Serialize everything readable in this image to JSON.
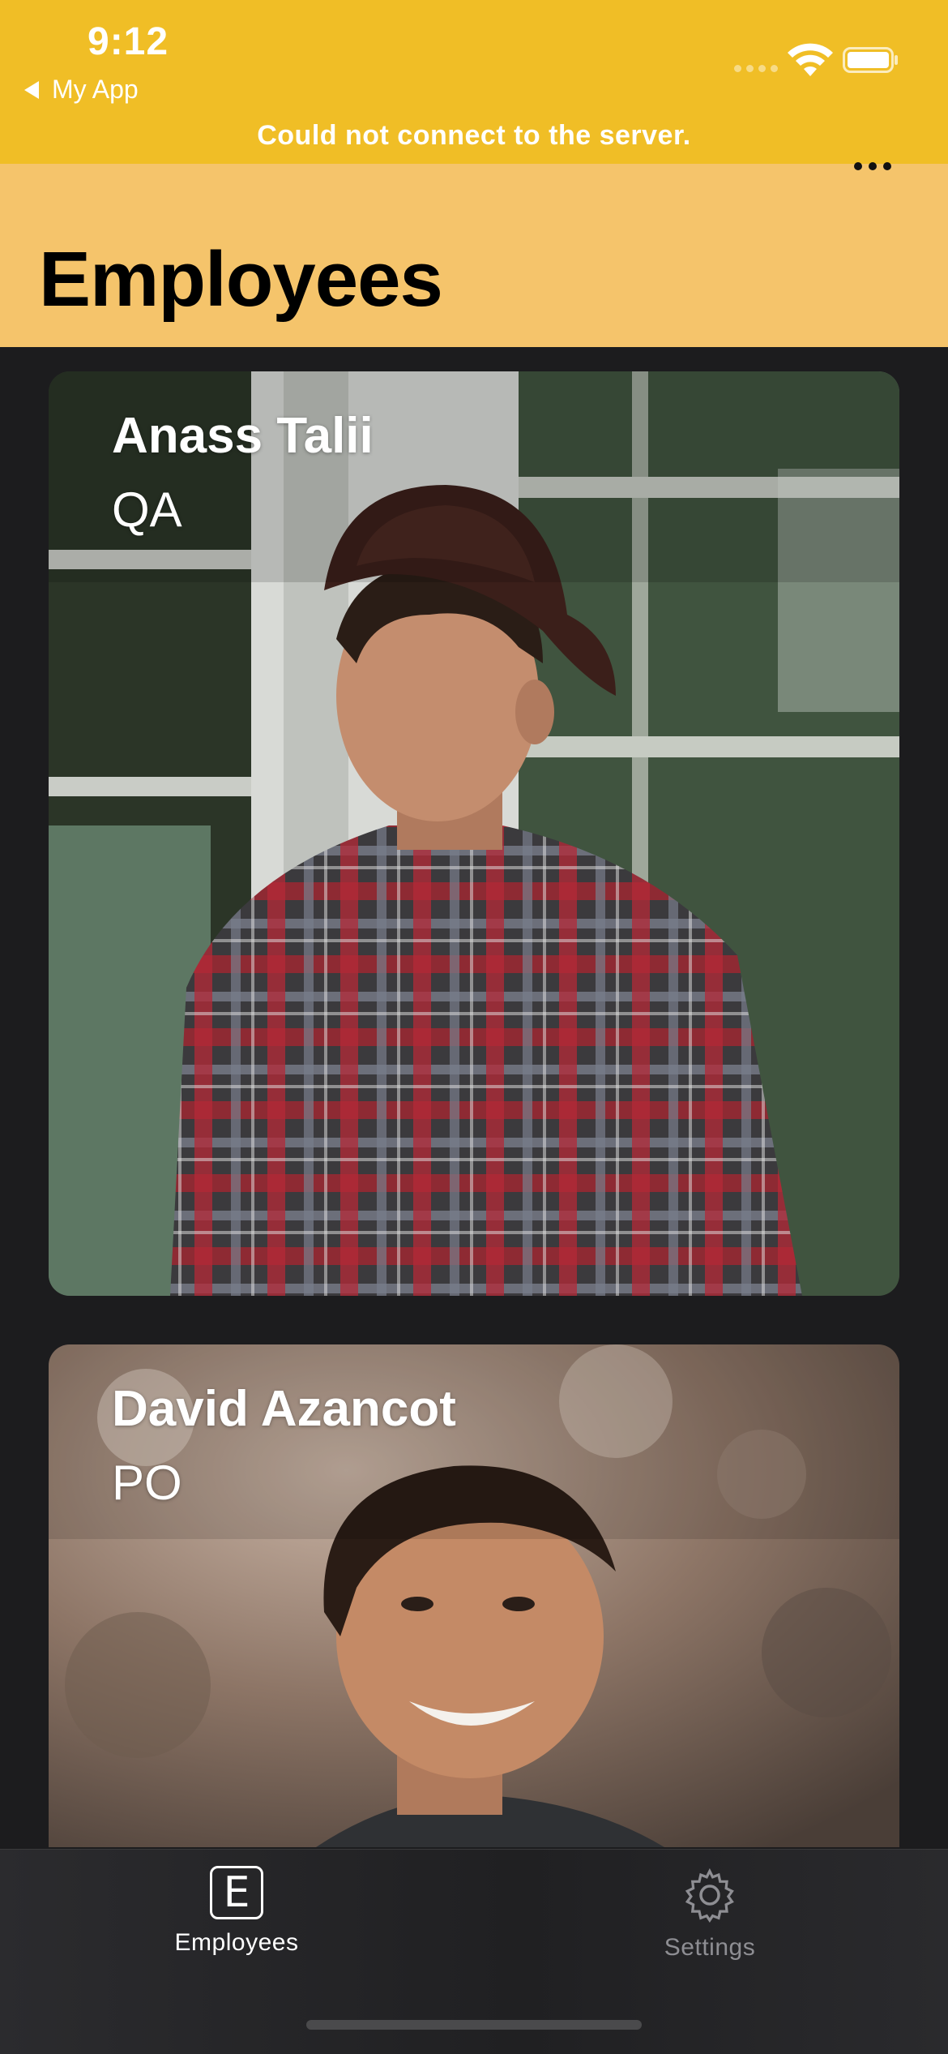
{
  "status_bar": {
    "time": "9:12",
    "back_app_label": "My App",
    "banner_message": "Could not connect to the server.",
    "banner_color": "#f0be26"
  },
  "nav": {
    "title": "Employees",
    "more_icon": "ellipsis-icon",
    "background_color": "#f5c46b"
  },
  "employees": [
    {
      "name": "Anass Talii",
      "role": "QA"
    },
    {
      "name": "David Azancot",
      "role": "PO"
    }
  ],
  "tab_bar": {
    "tabs": [
      {
        "label": "Employees",
        "icon": "E",
        "selected": true
      },
      {
        "label": "Settings",
        "icon": "gear-icon",
        "selected": false
      }
    ]
  }
}
